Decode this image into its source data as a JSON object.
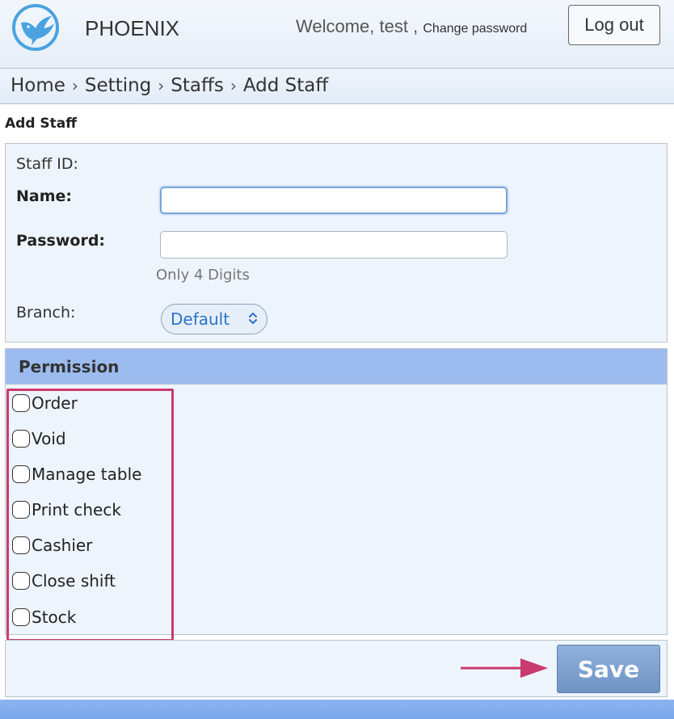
{
  "header": {
    "brand": "PHOENIX",
    "welcome_prefix": "Welcome, test",
    "welcome_sep": ",",
    "change_password": "Change password",
    "logout": "Log out",
    "logo_icon": "phoenix-bird-logo"
  },
  "breadcrumb": {
    "items": [
      "Home",
      "Setting",
      "Staffs",
      "Add Staff"
    ],
    "separator": "›"
  },
  "page": {
    "title": "Add Staff"
  },
  "form": {
    "staff_id_label": "Staff ID:",
    "name_label": "Name:",
    "name_value": "",
    "password_label": "Password:",
    "password_value": "",
    "password_hint": "Only 4 Digits",
    "branch_label": "Branch:",
    "branch_selected": "Default"
  },
  "permission": {
    "title": "Permission",
    "items": [
      {
        "label": "Order",
        "checked": false
      },
      {
        "label": "Void",
        "checked": false
      },
      {
        "label": "Manage table",
        "checked": false
      },
      {
        "label": "Print check",
        "checked": false
      },
      {
        "label": "Cashier",
        "checked": false
      },
      {
        "label": "Close shift",
        "checked": false
      },
      {
        "label": "Stock",
        "checked": false
      }
    ]
  },
  "footer": {
    "save": "Save"
  },
  "colors": {
    "accent": "#9cbcf0",
    "highlight": "#c93b6d",
    "link": "#2b73c8",
    "save": "#7a9dcf"
  }
}
